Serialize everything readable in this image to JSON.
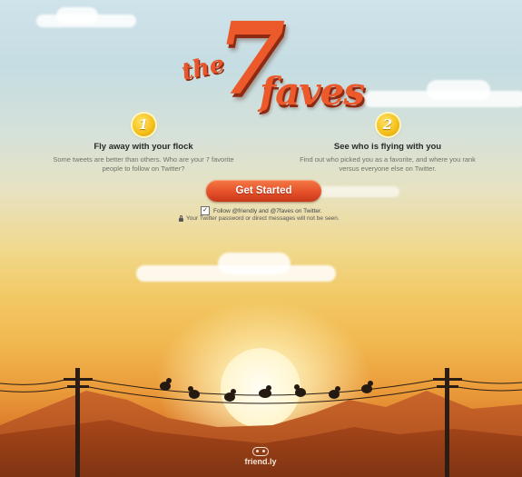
{
  "logo": {
    "the": "the",
    "seven": "7",
    "faves": "faves"
  },
  "steps": [
    {
      "number": "1",
      "title": "Fly away with your flock",
      "description": "Some tweets are better than others. Who are your 7 favorite people to follow on Twitter?"
    },
    {
      "number": "2",
      "title": "See who is flying with you",
      "description": "Find out who picked you as a favorite, and where you rank versus everyone else on Twitter."
    }
  ],
  "cta": {
    "label": "Get Started"
  },
  "follow": {
    "checked": "✓",
    "label": "Follow @friendly and @7faves on Twitter."
  },
  "notice": {
    "text": "Your Twitter password or direct messages will not be seen."
  },
  "footer": {
    "brand": "friend.ly"
  },
  "colors": {
    "accent": "#e5512a",
    "badge": "#f6c21c",
    "logo": "#ec5a2c"
  }
}
